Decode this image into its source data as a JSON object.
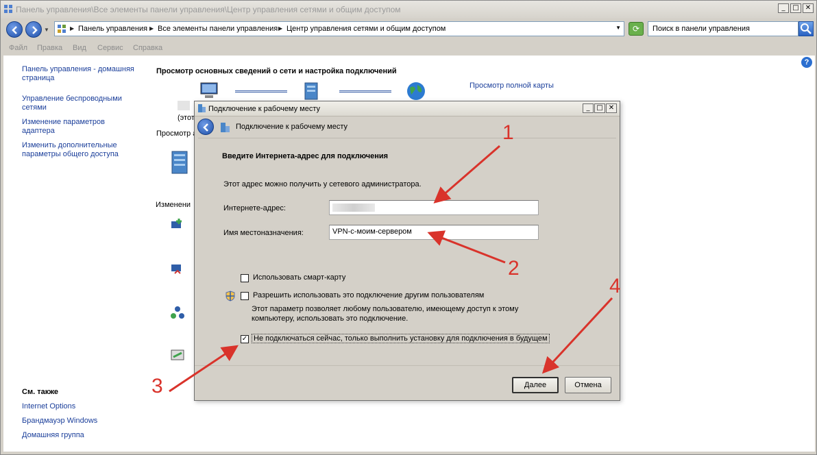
{
  "window": {
    "title": "Панель управления\\Все элементы панели управления\\Центр управления сетями и общим доступом",
    "caption_buttons": [
      "_",
      "□",
      "✕"
    ]
  },
  "address": {
    "crumbs": [
      "Панель управления",
      "Все элементы панели управления",
      "Центр управления сетями и общим доступом"
    ],
    "search_placeholder": "Поиск в панели управления"
  },
  "menu": [
    "Файл",
    "Правка",
    "Вид",
    "Сервис",
    "Справка"
  ],
  "sidebar": {
    "links": [
      "Панель управления - домашняя страница",
      "Управление беспроводными сетями",
      "Изменение параметров адаптера",
      "Изменить дополнительные параметры общего доступа"
    ],
    "see_also_title": "См. также",
    "see_also": [
      "Internet Options",
      "Брандмауэр Windows",
      "Домашняя группа"
    ]
  },
  "main": {
    "heading": "Просмотр основных сведений о сети и настройка подключений",
    "full_map_link": "Просмотр полной карты",
    "this_computer_label": "(этот",
    "view_active_label": "Просмотр а",
    "change_label": "Изменени"
  },
  "dialog": {
    "title": "Подключение к рабочему месту",
    "header": "Подключение к рабочему месту",
    "section_title": "Введите Интернета-адрес для подключения",
    "hint": "Этот адрес можно получить у сетевого администратора.",
    "address_label": "Интернете-адрес:",
    "address_value": "",
    "dest_label": "Имя местоназначения:",
    "dest_value": "VPN-с-моим-сервером",
    "checkbox_smartcard": "Использовать смарт-карту",
    "checkbox_share": "Разрешить использовать это подключение другим пользователям",
    "share_note": "Этот параметр позволяет любому пользователю, имеющему доступ к этому компьютеру, использовать это подключение.",
    "checkbox_later": "Не подключаться сейчас, только выполнить установку для подключения в будущем",
    "checkbox_later_checked": true,
    "next_button": "Далее",
    "cancel_button": "Отмена"
  },
  "annotations": [
    "1",
    "2",
    "3",
    "4"
  ],
  "colors": {
    "annotation": "#d9332b",
    "link": "#1a3e9a"
  }
}
